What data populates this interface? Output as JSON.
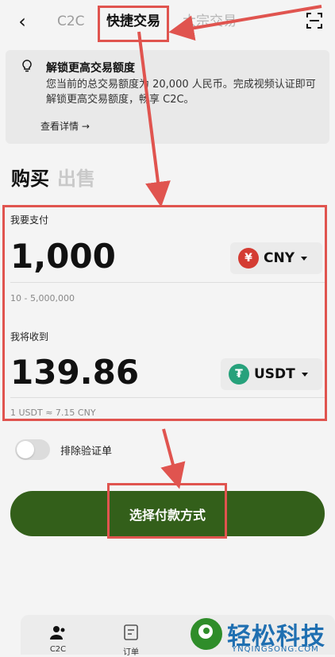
{
  "header": {
    "back_symbol": "‹",
    "tabs": [
      "C2C",
      "快捷交易",
      "大宗交易"
    ]
  },
  "banner": {
    "title": "解锁更高交易额度",
    "description": "您当前的总交易额度为 20,000 人民币。完成视频认证即可解锁更高交易额度，畅享 C2C。",
    "more": "查看详情 →"
  },
  "trade_tabs": {
    "buy": "购买",
    "sell": "出售"
  },
  "pay": {
    "label": "我要支付",
    "amount": "1,000",
    "currency_symbol": "¥",
    "currency": "CNY",
    "range": "10 - 5,000,000"
  },
  "receive": {
    "label": "我将收到",
    "amount": "139.86",
    "currency_symbol": "₮",
    "currency": "USDT",
    "rate": "1 USDT ≈ 7.15 CNY"
  },
  "toggle": {
    "label": "排除验证单",
    "on": false
  },
  "cta": {
    "label": "选择付款方式"
  },
  "bottom_nav": {
    "items": [
      "C2C",
      "订单"
    ]
  },
  "watermark": {
    "text": "轻松科技",
    "sub": "YNQINGSONG.COM"
  },
  "colors": {
    "primary_button": "#335f1a",
    "annotation": "#e0544f",
    "cny_badge": "#d43c33",
    "usdt_badge": "#26a17b"
  }
}
